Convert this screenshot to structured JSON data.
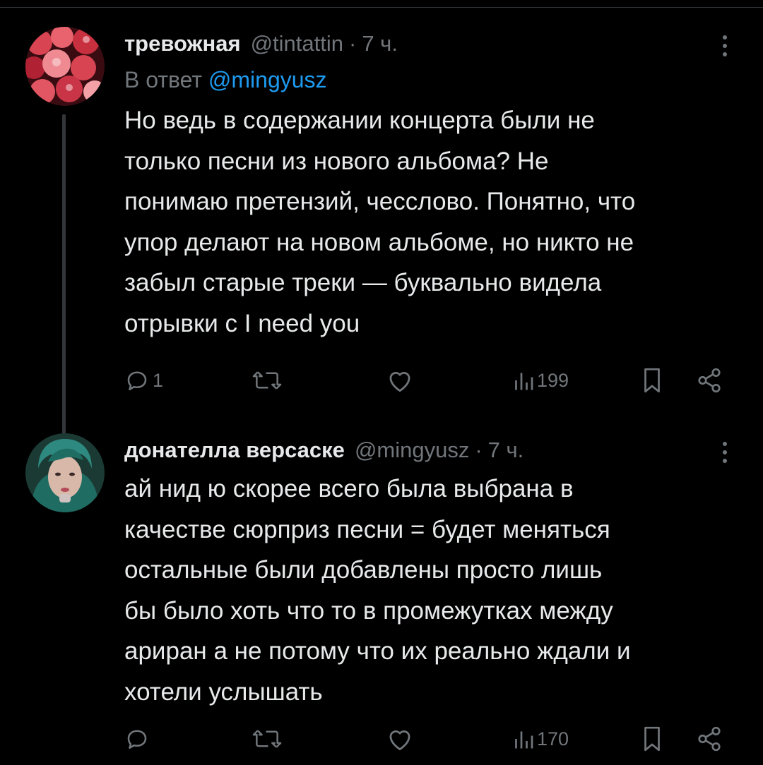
{
  "posts": [
    {
      "author_name": "тревожная",
      "handle": "@tintattin",
      "separator": "·",
      "time": "7 ч.",
      "reply_prefix": "В ответ",
      "reply_mention": "@mingyusz",
      "text_lines": [
        "Но ведь в содержании концерта были не",
        "только песни из нового альбома? Не",
        "понимаю претензий, чесслово. Понятно, что",
        "упор делают на новом альбоме, но никто не",
        "забыл старые треки — буквально видела",
        "отрывки с I need you"
      ],
      "reply_count": "1",
      "repost_count": "",
      "like_count": "",
      "views_count": "199",
      "avatar_icon": "cherries-avatar"
    },
    {
      "author_name": "донателла версаске",
      "handle": "@mingyusz",
      "separator": "·",
      "time": "7 ч.",
      "text_lines": [
        "ай нид ю скорее всего была выбрана в",
        "качестве сюрприз песни = будет меняться",
        "остальные были добавлены просто лишь",
        "бы было хоть что то в промежутках между",
        "ариран а не потому что их реально ждали и",
        "хотели услышать"
      ],
      "reply_count": "",
      "repost_count": "",
      "like_count": "",
      "views_count": "170",
      "avatar_icon": "person-avatar"
    }
  ],
  "colors": {
    "background": "#000000",
    "text": "#e7e9ea",
    "secondary": "#71767b",
    "link": "#1d9bf0",
    "divider": "#2f3336"
  }
}
